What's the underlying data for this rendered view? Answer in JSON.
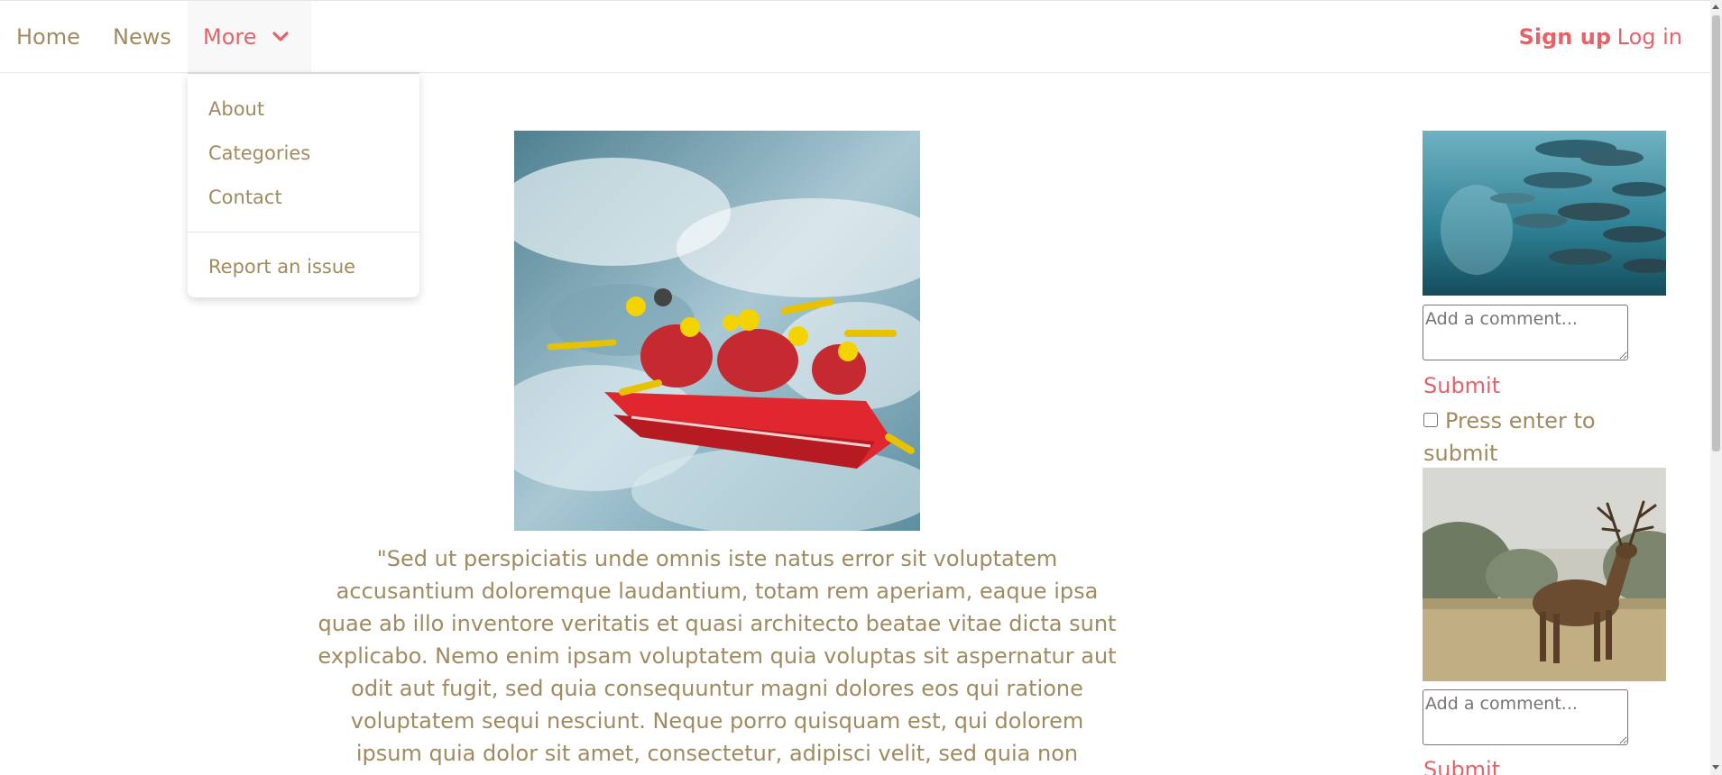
{
  "nav": {
    "home": "Home",
    "news": "News",
    "more": "More",
    "more_icon": "chevron-down-icon",
    "signup": "Sign up",
    "login": "Log in"
  },
  "dropdown": {
    "items": [
      "About",
      "Categories",
      "Contact"
    ],
    "report": "Report an issue"
  },
  "main": {
    "quote": "\"Sed ut perspiciatis unde omnis iste natus error sit voluptatem accusantium doloremque laudantium, totam rem aperiam, eaque ipsa quae ab illo inventore veritatis et quasi architecto beatae vitae dicta sunt explicabo. Nemo enim ipsam voluptatem quia voluptas sit aspernatur aut odit aut fugit, sed quia consequuntur magni dolores eos qui ratione voluptatem sequi nesciunt. Neque porro quisquam est, qui dolorem ipsum quia dolor sit amet, consectetur, adipisci velit, sed quia non"
  },
  "sidebar": {
    "comment_placeholder": "Add a comment...",
    "submit": "Submit",
    "enter_label": "Press enter to submit"
  },
  "colors": {
    "accent": "#e4636a",
    "text": "#a08a5f"
  }
}
